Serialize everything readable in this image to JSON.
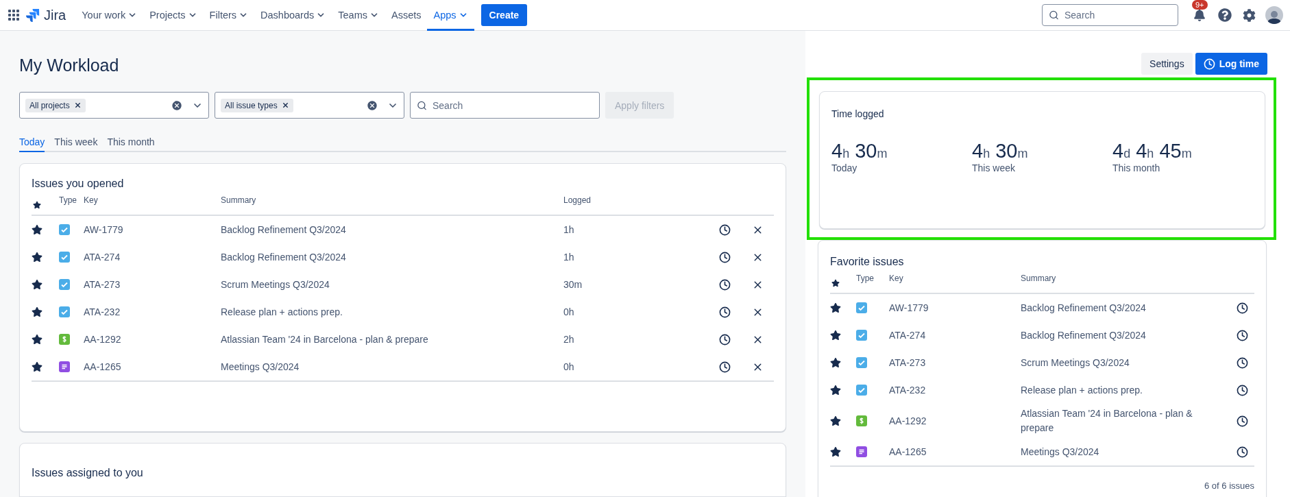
{
  "topbar": {
    "product": "Jira",
    "nav": [
      {
        "label": "Your work",
        "menu": true,
        "selected": false
      },
      {
        "label": "Projects",
        "menu": true,
        "selected": false
      },
      {
        "label": "Filters",
        "menu": true,
        "selected": false
      },
      {
        "label": "Dashboards",
        "menu": true,
        "selected": false
      },
      {
        "label": "Teams",
        "menu": true,
        "selected": false
      },
      {
        "label": "Assets",
        "menu": false,
        "selected": false
      },
      {
        "label": "Apps",
        "menu": true,
        "selected": true
      }
    ],
    "create": "Create",
    "search": {
      "placeholder": "Search"
    },
    "notifications": "9+"
  },
  "page": {
    "title": "My Workload",
    "filters": [
      {
        "chip": "All projects"
      },
      {
        "chip": "All issue types"
      }
    ],
    "search": {
      "placeholder": "Search"
    },
    "apply": {
      "label": "Apply filters",
      "disabled": true
    },
    "tabs": [
      {
        "label": "Today",
        "selected": true
      },
      {
        "label": "This week",
        "selected": false
      },
      {
        "label": "This month",
        "selected": false
      }
    ],
    "opened": {
      "title": "Issues you opened",
      "columns": [
        "Type",
        "Key",
        "Summary",
        "Logged"
      ],
      "rows": [
        {
          "starred": true,
          "kind": "task",
          "key": "AW-1779",
          "summary": "Backlog Refinement Q3/2024",
          "logged": "1h"
        },
        {
          "starred": true,
          "kind": "task",
          "key": "ATA-274",
          "summary": "Backlog Refinement Q3/2024",
          "logged": "1h"
        },
        {
          "starred": true,
          "kind": "task",
          "key": "ATA-273",
          "summary": "Scrum Meetings Q3/2024",
          "logged": "30m"
        },
        {
          "starred": true,
          "kind": "task",
          "key": "ATA-232",
          "summary": "Release plan + actions prep.",
          "logged": "0h"
        },
        {
          "starred": true,
          "kind": "cost",
          "key": "AA-1292",
          "summary": "Atlassian Team '24 in Barcelona - plan & prepare",
          "logged": "2h"
        },
        {
          "starred": true,
          "kind": "doc",
          "key": "AA-1265",
          "summary": "Meetings Q3/2024",
          "logged": "0h"
        }
      ]
    },
    "assigned": {
      "title": "Issues assigned to you"
    }
  },
  "side": {
    "settings": "Settings",
    "log_time": "Log time",
    "time_logged": {
      "title": "Time logged",
      "highlighted": true,
      "stats": [
        {
          "parts": [
            {
              "value": "4",
              "unit": "h"
            },
            {
              "value": "30",
              "unit": "m"
            }
          ],
          "label": "Today"
        },
        {
          "parts": [
            {
              "value": "4",
              "unit": "h"
            },
            {
              "value": "30",
              "unit": "m"
            }
          ],
          "label": "This week"
        },
        {
          "parts": [
            {
              "value": "4",
              "unit": "d"
            },
            {
              "value": "4",
              "unit": "h"
            },
            {
              "value": "45",
              "unit": "m"
            }
          ],
          "label": "This month"
        }
      ]
    },
    "favorites": {
      "title": "Favorite issues",
      "columns": [
        "Type",
        "Key",
        "Summary"
      ],
      "rows": [
        {
          "starred": true,
          "kind": "task",
          "key": "AW-1779",
          "summary": "Backlog Refinement Q3/2024"
        },
        {
          "starred": true,
          "kind": "task",
          "key": "ATA-274",
          "summary": "Backlog Refinement Q3/2024"
        },
        {
          "starred": true,
          "kind": "task",
          "key": "ATA-273",
          "summary": "Scrum Meetings Q3/2024"
        },
        {
          "starred": true,
          "kind": "task",
          "key": "ATA-232",
          "summary": "Release plan + actions prep."
        },
        {
          "starred": true,
          "kind": "cost",
          "key": "AA-1292",
          "summary": "Atlassian Team '24 in Barcelona - plan & prepare"
        },
        {
          "starred": true,
          "kind": "doc",
          "key": "AA-1265",
          "summary": "Meetings Q3/2024"
        }
      ],
      "count": "6 of 6 issues"
    }
  }
}
